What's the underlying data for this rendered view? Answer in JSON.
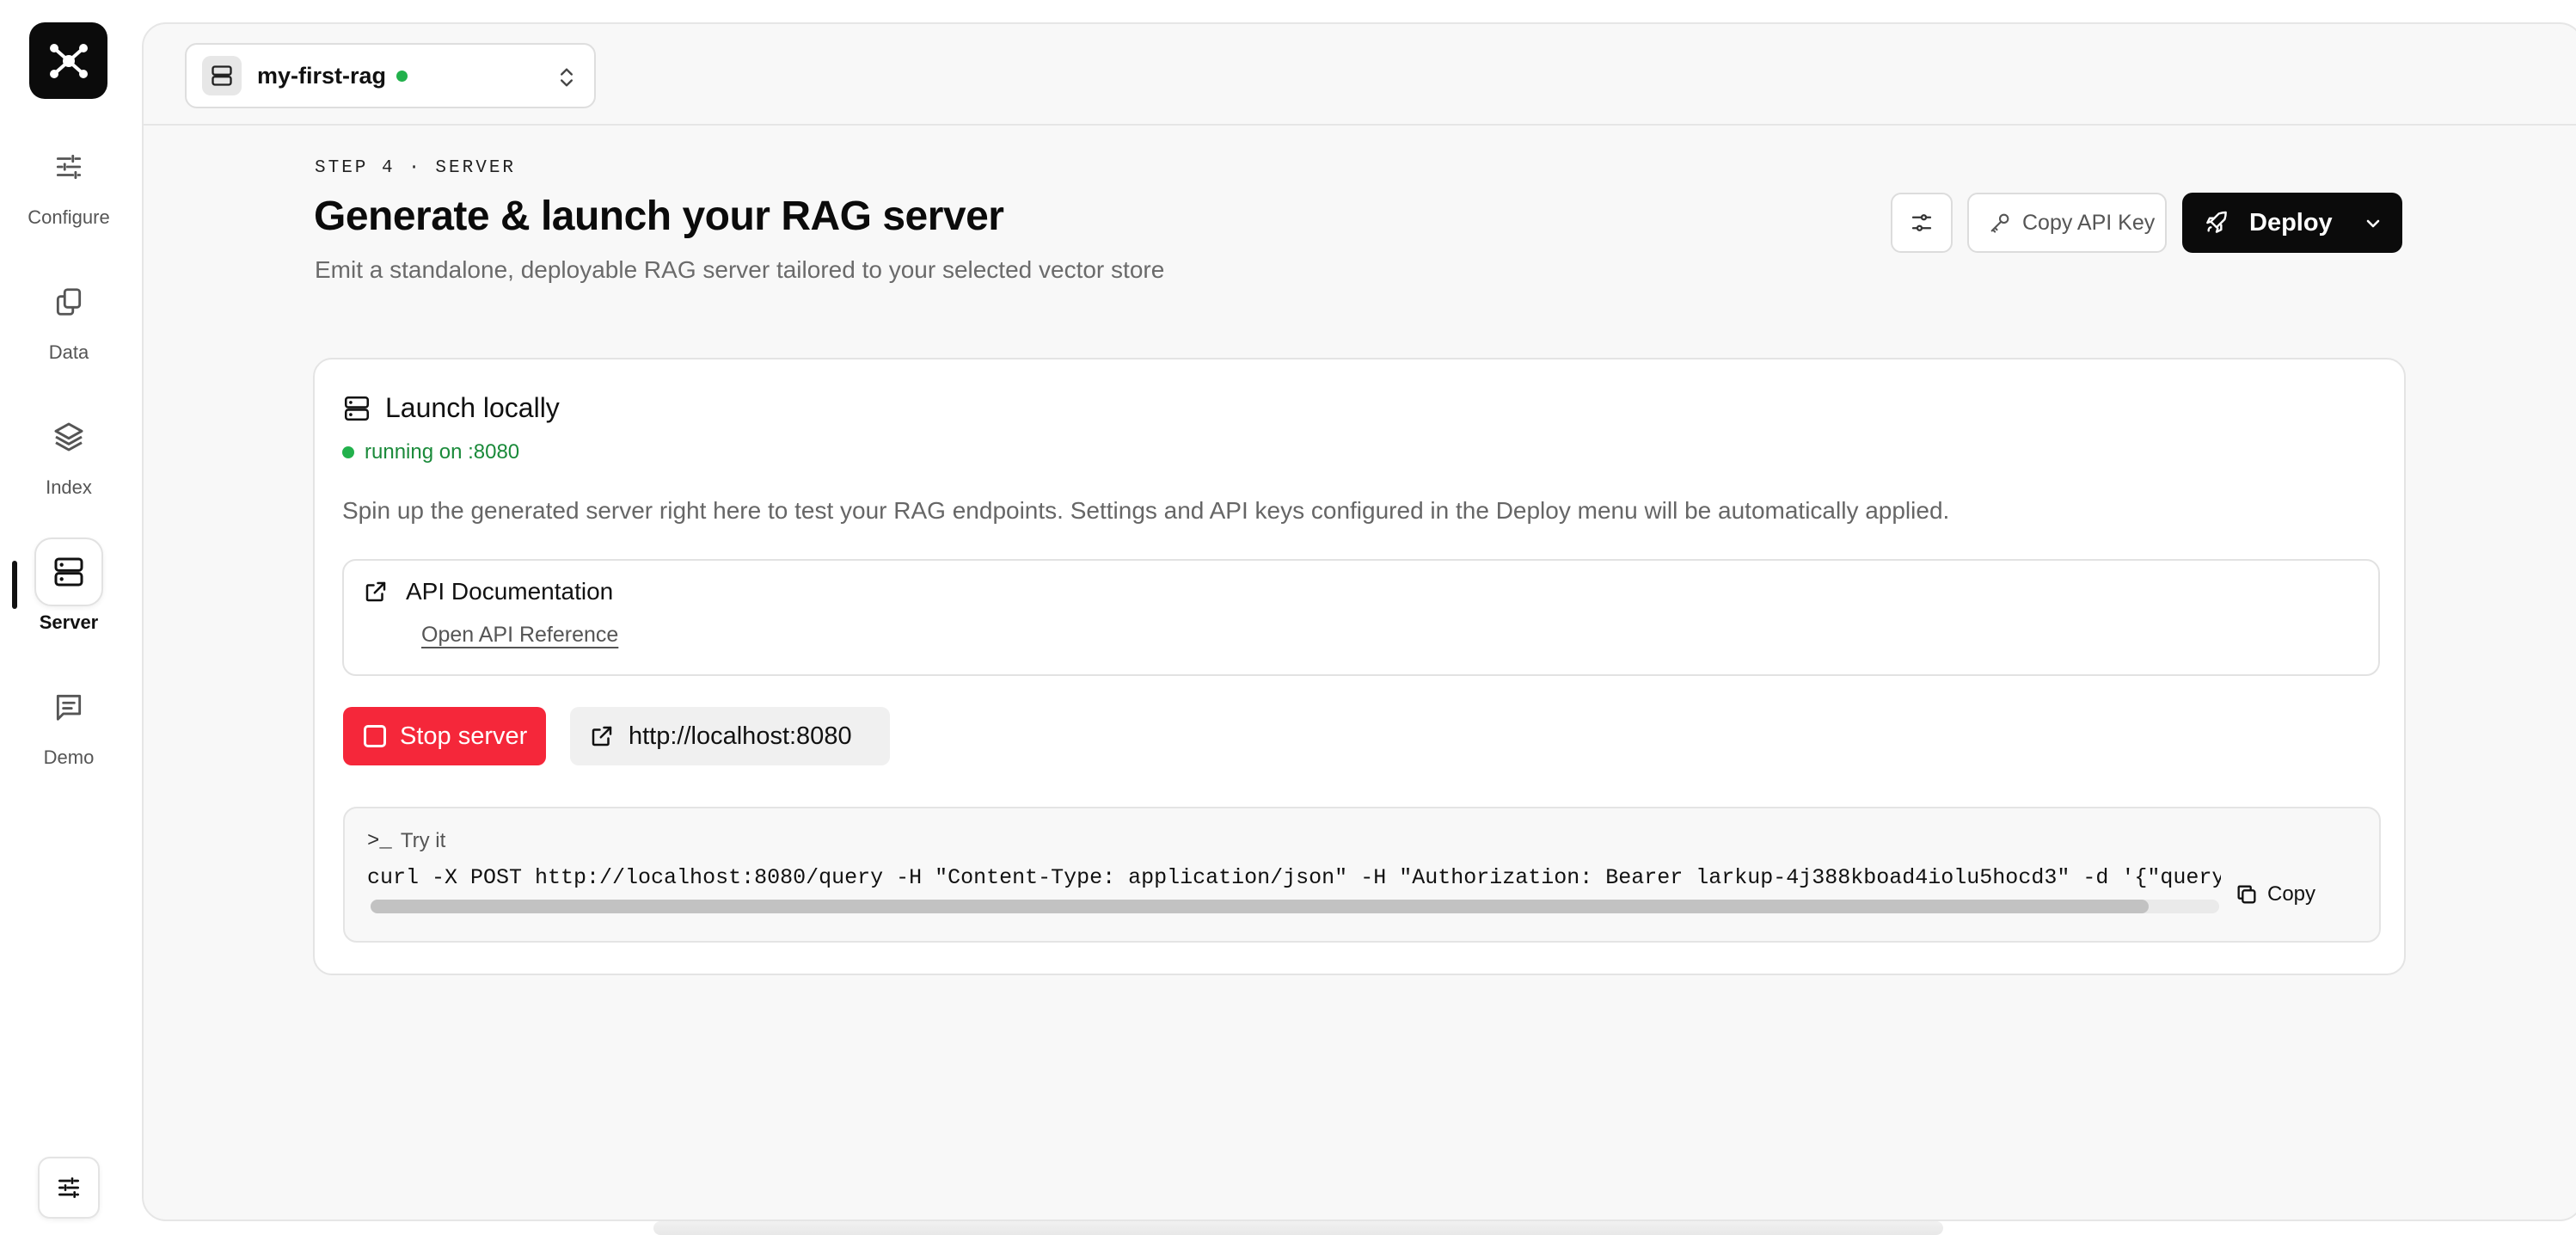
{
  "sidebar": {
    "items": [
      {
        "label": "Configure",
        "icon": "sliders-icon"
      },
      {
        "label": "Data",
        "icon": "files-icon"
      },
      {
        "label": "Index",
        "icon": "layers-icon"
      },
      {
        "label": "Server",
        "icon": "server-icon",
        "active": true
      },
      {
        "label": "Demo",
        "icon": "chat-icon"
      }
    ]
  },
  "project": {
    "name": "my-first-rag",
    "status_color": "#22b14c"
  },
  "header": {
    "step": "STEP 4 · SERVER",
    "title": "Generate & launch your RAG server",
    "subtitle": "Emit a standalone, deployable RAG server tailored to your selected vector store",
    "copy_key_label": "Copy API Key",
    "deploy_label": "Deploy"
  },
  "launch": {
    "title": "Launch locally",
    "status": "running on :8080",
    "description": "Spin up the generated server right here to test your RAG endpoints. Settings and API keys configured in the Deploy menu will be automatically applied.",
    "docs_title": "API Documentation",
    "docs_link": "Open API Reference",
    "stop_label": "Stop server",
    "url_label": "http://localhost:8080",
    "try_label": "Try it",
    "try_prompt": ">_",
    "curl": "curl -X POST http://localhost:8080/query -H \"Content-Type: application/json\" -H \"Authorization: Bearer larkup-4j388kboad4iolu5hocd3\" -d '{\"query\":\"hel",
    "copy_label": "Copy"
  },
  "colors": {
    "accent": "#0b0b0b",
    "danger": "#f5273a",
    "success": "#22b14c"
  }
}
